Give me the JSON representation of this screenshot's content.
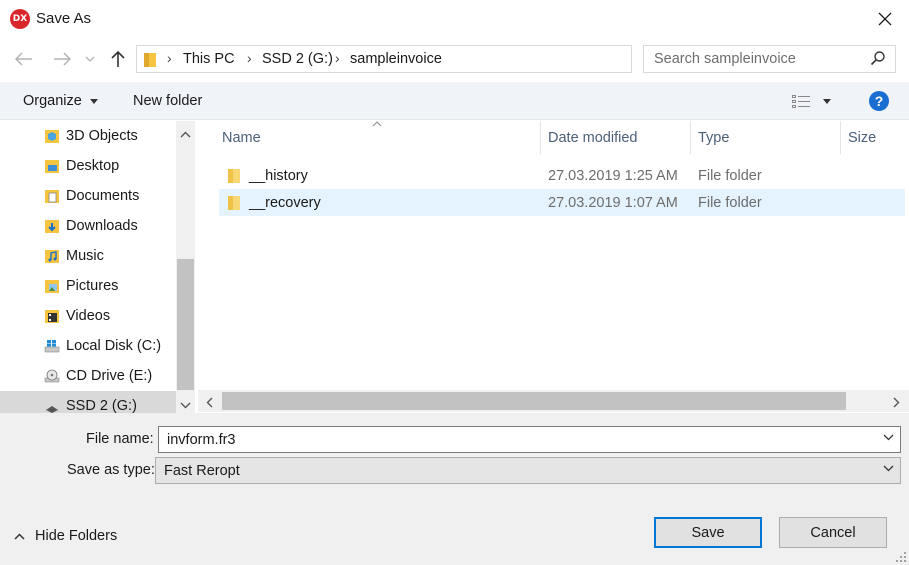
{
  "window": {
    "title": "Save As",
    "app_icon_text": "DX"
  },
  "nav": {
    "back_icon": "arrow-left-icon",
    "forward_icon": "arrow-right-icon",
    "up_icon": "arrow-up-icon",
    "breadcrumb": [
      "This PC",
      "SSD 2 (G:)",
      "sampleinvoice"
    ],
    "search_placeholder": "Search sampleinvoice"
  },
  "toolbar": {
    "organize_label": "Organize",
    "new_folder_label": "New folder",
    "help_label": "?"
  },
  "sidebar": {
    "items": [
      {
        "label": "3D Objects",
        "icon": "3d-objects-icon"
      },
      {
        "label": "Desktop",
        "icon": "desktop-folder-icon"
      },
      {
        "label": "Documents",
        "icon": "documents-icon"
      },
      {
        "label": "Downloads",
        "icon": "downloads-icon"
      },
      {
        "label": "Music",
        "icon": "music-icon"
      },
      {
        "label": "Pictures",
        "icon": "pictures-icon"
      },
      {
        "label": "Videos",
        "icon": "videos-icon"
      },
      {
        "label": "Local Disk (C:)",
        "icon": "windows-drive-icon"
      },
      {
        "label": "CD Drive (E:)",
        "icon": "cd-drive-icon"
      },
      {
        "label": "SSD 2 (G:)",
        "icon": "drive-icon",
        "selected": true
      }
    ]
  },
  "filelist": {
    "columns": [
      "Name",
      "Date modified",
      "Type",
      "Size"
    ],
    "rows": [
      {
        "name": "__history",
        "date": "27.03.2019 1:25 AM",
        "type": "File folder",
        "selected": false
      },
      {
        "name": "__recovery",
        "date": "27.03.2019 1:07 AM",
        "type": "File folder",
        "selected": true
      }
    ]
  },
  "form": {
    "file_name_label": "File name:",
    "file_name_value": "invform.fr3",
    "save_type_label": "Save as type:",
    "save_type_value": "Fast Reropt"
  },
  "footer": {
    "hide_folders_label": "Hide Folders",
    "save_label": "Save",
    "cancel_label": "Cancel"
  },
  "colors": {
    "accent": "#0078d7",
    "selection": "#e5f3ff",
    "folder": "#f5c542",
    "help": "#1a6dd1",
    "app_icon": "#d8262b"
  }
}
